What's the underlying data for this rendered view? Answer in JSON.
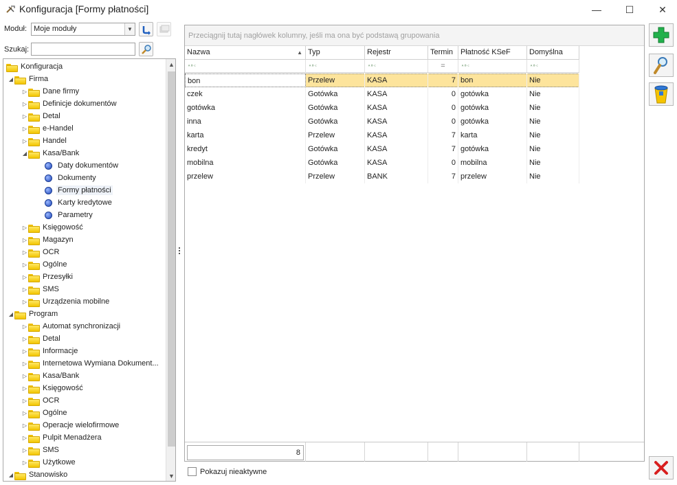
{
  "window": {
    "title": "Konfiguracja [Formy płatności]",
    "min_glyph": "—",
    "max_glyph": "☐",
    "close_glyph": "✕"
  },
  "left": {
    "module_label": "Moduł:",
    "module_value": "Moje moduły",
    "search_label": "Szukaj:",
    "search_value": ""
  },
  "tree": [
    {
      "level": 0,
      "exp": "",
      "label": "Konfiguracja",
      "icon": "folder"
    },
    {
      "level": 1,
      "exp": "◢",
      "label": "Firma",
      "icon": "folder"
    },
    {
      "level": 2,
      "exp": "▷",
      "label": "Dane firmy",
      "icon": "folder"
    },
    {
      "level": 2,
      "exp": "▷",
      "label": "Definicje dokumentów",
      "icon": "folder"
    },
    {
      "level": 2,
      "exp": "▷",
      "label": "Detal",
      "icon": "folder"
    },
    {
      "level": 2,
      "exp": "▷",
      "label": "e-Handel",
      "icon": "folder"
    },
    {
      "level": 2,
      "exp": "▷",
      "label": "Handel",
      "icon": "folder"
    },
    {
      "level": 2,
      "exp": "◢",
      "label": "Kasa/Bank",
      "icon": "folder"
    },
    {
      "level": 3,
      "exp": "",
      "label": "Daty dokumentów",
      "icon": "leaf"
    },
    {
      "level": 3,
      "exp": "",
      "label": "Dokumenty",
      "icon": "leaf"
    },
    {
      "level": 3,
      "exp": "",
      "label": "Formy płatności",
      "icon": "leaf",
      "selected": true
    },
    {
      "level": 3,
      "exp": "",
      "label": "Karty kredytowe",
      "icon": "leaf"
    },
    {
      "level": 3,
      "exp": "",
      "label": "Parametry",
      "icon": "leaf"
    },
    {
      "level": 2,
      "exp": "▷",
      "label": "Księgowość",
      "icon": "folder"
    },
    {
      "level": 2,
      "exp": "▷",
      "label": "Magazyn",
      "icon": "folder"
    },
    {
      "level": 2,
      "exp": "▷",
      "label": "OCR",
      "icon": "folder"
    },
    {
      "level": 2,
      "exp": "▷",
      "label": "Ogólne",
      "icon": "folder"
    },
    {
      "level": 2,
      "exp": "▷",
      "label": "Przesyłki",
      "icon": "folder"
    },
    {
      "level": 2,
      "exp": "▷",
      "label": "SMS",
      "icon": "folder"
    },
    {
      "level": 2,
      "exp": "▷",
      "label": "Urządzenia mobilne",
      "icon": "folder"
    },
    {
      "level": 1,
      "exp": "◢",
      "label": "Program",
      "icon": "folder"
    },
    {
      "level": 2,
      "exp": "▷",
      "label": "Automat synchronizacji",
      "icon": "folder"
    },
    {
      "level": 2,
      "exp": "▷",
      "label": "Detal",
      "icon": "folder"
    },
    {
      "level": 2,
      "exp": "▷",
      "label": "Informacje",
      "icon": "folder"
    },
    {
      "level": 2,
      "exp": "▷",
      "label": "Internetowa Wymiana Dokument...",
      "icon": "folder"
    },
    {
      "level": 2,
      "exp": "▷",
      "label": "Kasa/Bank",
      "icon": "folder"
    },
    {
      "level": 2,
      "exp": "▷",
      "label": "Księgowość",
      "icon": "folder"
    },
    {
      "level": 2,
      "exp": "▷",
      "label": "OCR",
      "icon": "folder"
    },
    {
      "level": 2,
      "exp": "▷",
      "label": "Ogólne",
      "icon": "folder"
    },
    {
      "level": 2,
      "exp": "▷",
      "label": "Operacje wielofirmowe",
      "icon": "folder"
    },
    {
      "level": 2,
      "exp": "▷",
      "label": "Pulpit Menadżera",
      "icon": "folder"
    },
    {
      "level": 2,
      "exp": "▷",
      "label": "SMS",
      "icon": "folder"
    },
    {
      "level": 2,
      "exp": "▷",
      "label": "Użytkowe",
      "icon": "folder"
    },
    {
      "level": 1,
      "exp": "◢",
      "label": "Stanowisko",
      "icon": "folder"
    }
  ],
  "grid": {
    "group_hint": "Przeciągnij tutaj nagłówek kolumny, jeśli ma ona być podstawą grupowania",
    "columns": [
      {
        "key": "nazwa",
        "label": "Nazwa",
        "filter": "abc",
        "sorted": true
      },
      {
        "key": "typ",
        "label": "Typ",
        "filter": "abc"
      },
      {
        "key": "rejestr",
        "label": "Rejestr",
        "filter": "abc"
      },
      {
        "key": "termin",
        "label": "Termin",
        "filter": "eq",
        "numeric": true
      },
      {
        "key": "ksef",
        "label": "Płatność KSeF",
        "filter": "abc"
      },
      {
        "key": "domyslna",
        "label": "Domyślna",
        "filter": "abc"
      }
    ],
    "filter_abc_glyph": "ᴬᴮᶜ",
    "filter_eq_glyph": "=",
    "sort_glyph": "▲",
    "rows": [
      {
        "nazwa": "bon",
        "typ": "Przelew",
        "rejestr": "KASA",
        "termin": "7",
        "ksef": "bon",
        "domyslna": "Nie",
        "selected": true
      },
      {
        "nazwa": "czek",
        "typ": "Gotówka",
        "rejestr": "KASA",
        "termin": "0",
        "ksef": "gotówka",
        "domyslna": "Nie"
      },
      {
        "nazwa": "gotówka",
        "typ": "Gotówka",
        "rejestr": "KASA",
        "termin": "0",
        "ksef": "gotówka",
        "domyslna": "Nie"
      },
      {
        "nazwa": "inna",
        "typ": "Gotówka",
        "rejestr": "KASA",
        "termin": "0",
        "ksef": "gotówka",
        "domyslna": "Nie"
      },
      {
        "nazwa": "karta",
        "typ": "Przelew",
        "rejestr": "KASA",
        "termin": "7",
        "ksef": "karta",
        "domyslna": "Nie"
      },
      {
        "nazwa": "kredyt",
        "typ": "Gotówka",
        "rejestr": "KASA",
        "termin": "7",
        "ksef": "gotówka",
        "domyslna": "Nie"
      },
      {
        "nazwa": "mobilna",
        "typ": "Gotówka",
        "rejestr": "KASA",
        "termin": "0",
        "ksef": "mobilna",
        "domyslna": "Nie"
      },
      {
        "nazwa": "przelew",
        "typ": "Przelew",
        "rejestr": "BANK",
        "termin": "7",
        "ksef": "przelew",
        "domyslna": "Nie"
      }
    ],
    "footer_count": "8"
  },
  "options": {
    "show_inactive_label": "Pokazuj nieaktywne",
    "show_inactive_checked": false
  },
  "toolbar": {
    "add_icon": "plus-icon",
    "edit_icon": "magnifier-icon",
    "delete_icon": "trash-icon",
    "close_icon": "close-x-icon"
  },
  "colors": {
    "selected_row": "#fde49c",
    "add_green": "#22b14c",
    "close_red": "#d81e1e"
  }
}
